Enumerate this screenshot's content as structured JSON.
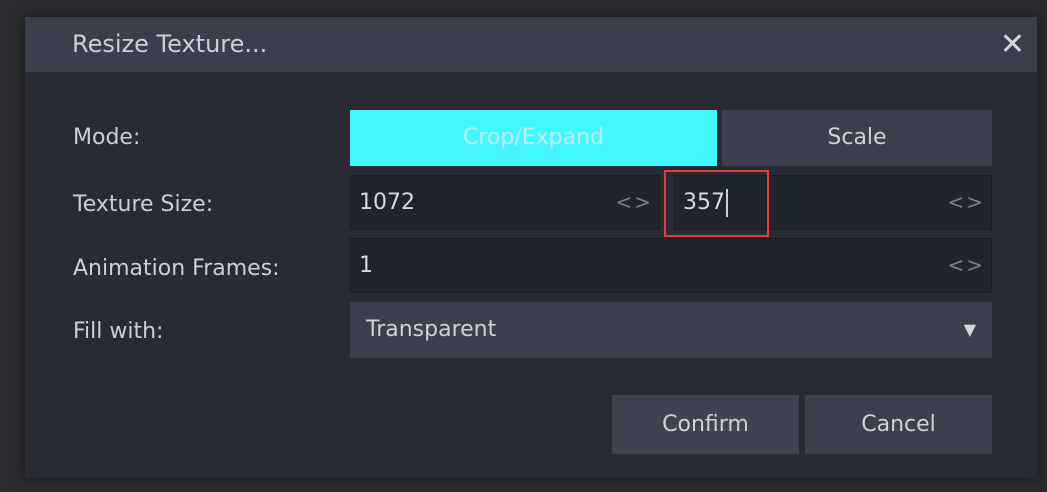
{
  "dialog": {
    "title": "Resize Texture...",
    "close_icon": "close-icon"
  },
  "mode": {
    "label": "Mode:",
    "options": [
      "Crop/Expand",
      "Scale"
    ],
    "selected": "Crop/Expand",
    "accent": "#42f8fe"
  },
  "texture_size": {
    "label": "Texture Size:",
    "width": "1072",
    "height": "357"
  },
  "animation_frames": {
    "label": "Animation Frames:",
    "value": "1"
  },
  "fill": {
    "label": "Fill with:",
    "value": "Transparent"
  },
  "buttons": {
    "confirm": "Confirm",
    "cancel": "Cancel"
  },
  "spinner_glyph": "<>"
}
